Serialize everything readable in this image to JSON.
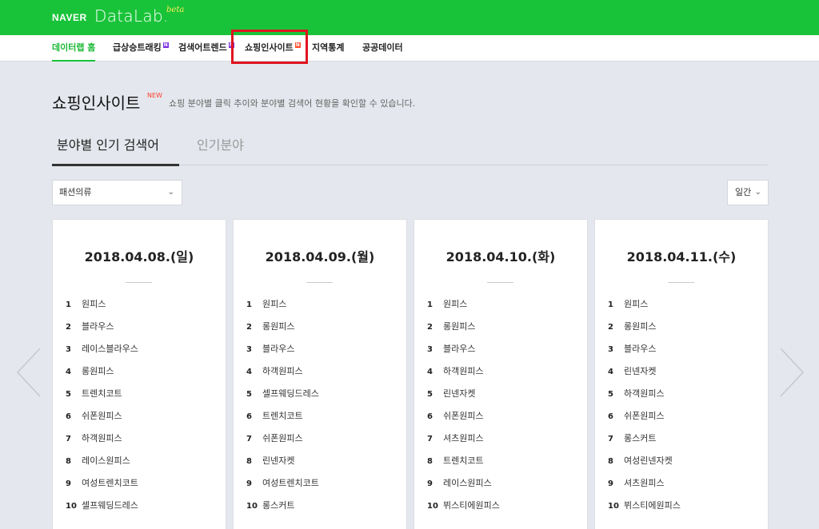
{
  "header": {
    "logo_naver": "NAVER",
    "logo_datalab": "DataLab.",
    "logo_beta": "beta",
    "brand_color": "#19c339"
  },
  "nav": {
    "items": [
      {
        "label": "데이터랩 홈",
        "active": true,
        "badge": ""
      },
      {
        "label": "급상승트래킹",
        "active": false,
        "badge": "N"
      },
      {
        "label": "검색어트렌드",
        "active": false,
        "badge": "N"
      },
      {
        "label": "쇼핑인사이트",
        "active": false,
        "badge": "N"
      },
      {
        "label": "지역통계",
        "active": false,
        "badge": ""
      },
      {
        "label": "공공데이터",
        "active": false,
        "badge": ""
      }
    ]
  },
  "page": {
    "title": "쇼핑인사이트",
    "title_badge": "NEW",
    "description": "쇼핑 분야별 클릭 추이와 분야별 검색어 현황을 확인할 수 있습니다."
  },
  "tabs": [
    {
      "label": "분야별 인기 검색어",
      "active": true
    },
    {
      "label": "인기분야",
      "active": false
    }
  ],
  "filters": {
    "category": "패션의류",
    "period": "일간"
  },
  "cards": [
    {
      "date": "2018.04.08.(일)",
      "ranks": [
        "원피스",
        "블라우스",
        "레이스블라우스",
        "롱원피스",
        "트렌치코트",
        "쉬폰원피스",
        "하객원피스",
        "레이스원피스",
        "여성트렌치코트",
        "셀프웨딩드레스"
      ]
    },
    {
      "date": "2018.04.09.(월)",
      "ranks": [
        "원피스",
        "롱원피스",
        "블라우스",
        "하객원피스",
        "셀프웨딩드레스",
        "트렌치코트",
        "쉬폰원피스",
        "린넨자켓",
        "여성트렌치코트",
        "롱스커트"
      ]
    },
    {
      "date": "2018.04.10.(화)",
      "ranks": [
        "원피스",
        "롱원피스",
        "블라우스",
        "하객원피스",
        "린넨자켓",
        "쉬폰원피스",
        "셔츠원피스",
        "트렌치코트",
        "레이스원피스",
        "뷔스티에원피스"
      ]
    },
    {
      "date": "2018.04.11.(수)",
      "ranks": [
        "원피스",
        "롱원피스",
        "블라우스",
        "린넨자켓",
        "하객원피스",
        "쉬폰원피스",
        "롱스커트",
        "여성린넨자켓",
        "셔츠원피스",
        "뷔스티에원피스"
      ]
    }
  ],
  "icons": {
    "prev": "chevron-left-icon",
    "next": "chevron-right-icon",
    "dropdown": "chevron-down-icon"
  }
}
